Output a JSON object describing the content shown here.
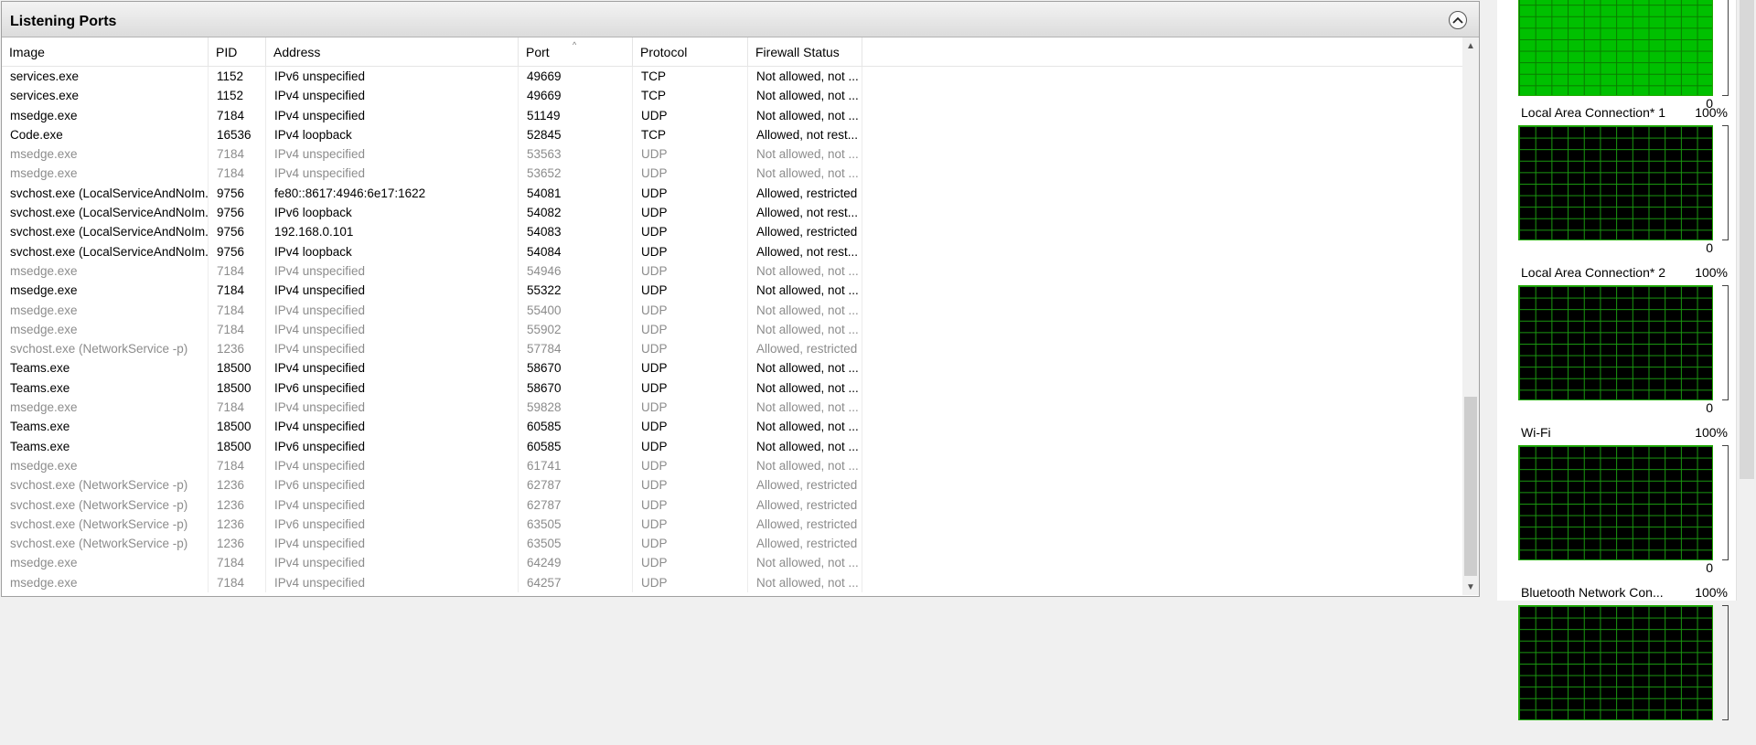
{
  "panel": {
    "title": "Listening Ports",
    "collapse_icon": "chevron-up-icon"
  },
  "columns": [
    "Image",
    "PID",
    "Address",
    "Port",
    "Protocol",
    "Firewall Status"
  ],
  "sorted_column": "Port",
  "rows": [
    {
      "image": "services.exe",
      "pid": "1152",
      "address": "IPv6 unspecified",
      "port": "49669",
      "protocol": "TCP",
      "firewall": "Not allowed, not ...",
      "dim": false
    },
    {
      "image": "services.exe",
      "pid": "1152",
      "address": "IPv4 unspecified",
      "port": "49669",
      "protocol": "TCP",
      "firewall": "Not allowed, not ...",
      "dim": false
    },
    {
      "image": "msedge.exe",
      "pid": "7184",
      "address": "IPv4 unspecified",
      "port": "51149",
      "protocol": "UDP",
      "firewall": "Not allowed, not ...",
      "dim": false
    },
    {
      "image": "Code.exe",
      "pid": "16536",
      "address": "IPv4 loopback",
      "port": "52845",
      "protocol": "TCP",
      "firewall": "Allowed, not rest...",
      "dim": false
    },
    {
      "image": "msedge.exe",
      "pid": "7184",
      "address": "IPv4 unspecified",
      "port": "53563",
      "protocol": "UDP",
      "firewall": "Not allowed, not ...",
      "dim": true
    },
    {
      "image": "msedge.exe",
      "pid": "7184",
      "address": "IPv4 unspecified",
      "port": "53652",
      "protocol": "UDP",
      "firewall": "Not allowed, not ...",
      "dim": true
    },
    {
      "image": "svchost.exe (LocalServiceAndNoIm...",
      "pid": "9756",
      "address": "fe80::8617:4946:6e17:1622",
      "port": "54081",
      "protocol": "UDP",
      "firewall": "Allowed, restricted",
      "dim": false
    },
    {
      "image": "svchost.exe (LocalServiceAndNoIm...",
      "pid": "9756",
      "address": "IPv6 loopback",
      "port": "54082",
      "protocol": "UDP",
      "firewall": "Allowed, not rest...",
      "dim": false
    },
    {
      "image": "svchost.exe (LocalServiceAndNoIm...",
      "pid": "9756",
      "address": "192.168.0.101",
      "port": "54083",
      "protocol": "UDP",
      "firewall": "Allowed, restricted",
      "dim": false
    },
    {
      "image": "svchost.exe (LocalServiceAndNoIm...",
      "pid": "9756",
      "address": "IPv4 loopback",
      "port": "54084",
      "protocol": "UDP",
      "firewall": "Allowed, not rest...",
      "dim": false
    },
    {
      "image": "msedge.exe",
      "pid": "7184",
      "address": "IPv4 unspecified",
      "port": "54946",
      "protocol": "UDP",
      "firewall": "Not allowed, not ...",
      "dim": true
    },
    {
      "image": "msedge.exe",
      "pid": "7184",
      "address": "IPv4 unspecified",
      "port": "55322",
      "protocol": "UDP",
      "firewall": "Not allowed, not ...",
      "dim": false
    },
    {
      "image": "msedge.exe",
      "pid": "7184",
      "address": "IPv4 unspecified",
      "port": "55400",
      "protocol": "UDP",
      "firewall": "Not allowed, not ...",
      "dim": true
    },
    {
      "image": "msedge.exe",
      "pid": "7184",
      "address": "IPv4 unspecified",
      "port": "55902",
      "protocol": "UDP",
      "firewall": "Not allowed, not ...",
      "dim": true
    },
    {
      "image": "svchost.exe (NetworkService -p)",
      "pid": "1236",
      "address": "IPv4 unspecified",
      "port": "57784",
      "protocol": "UDP",
      "firewall": "Allowed, restricted",
      "dim": true
    },
    {
      "image": "Teams.exe",
      "pid": "18500",
      "address": "IPv4 unspecified",
      "port": "58670",
      "protocol": "UDP",
      "firewall": "Not allowed, not ...",
      "dim": false
    },
    {
      "image": "Teams.exe",
      "pid": "18500",
      "address": "IPv6 unspecified",
      "port": "58670",
      "protocol": "UDP",
      "firewall": "Not allowed, not ...",
      "dim": false
    },
    {
      "image": "msedge.exe",
      "pid": "7184",
      "address": "IPv4 unspecified",
      "port": "59828",
      "protocol": "UDP",
      "firewall": "Not allowed, not ...",
      "dim": true
    },
    {
      "image": "Teams.exe",
      "pid": "18500",
      "address": "IPv4 unspecified",
      "port": "60585",
      "protocol": "UDP",
      "firewall": "Not allowed, not ...",
      "dim": false
    },
    {
      "image": "Teams.exe",
      "pid": "18500",
      "address": "IPv6 unspecified",
      "port": "60585",
      "protocol": "UDP",
      "firewall": "Not allowed, not ...",
      "dim": false
    },
    {
      "image": "msedge.exe",
      "pid": "7184",
      "address": "IPv4 unspecified",
      "port": "61741",
      "protocol": "UDP",
      "firewall": "Not allowed, not ...",
      "dim": true
    },
    {
      "image": "svchost.exe (NetworkService -p)",
      "pid": "1236",
      "address": "IPv6 unspecified",
      "port": "62787",
      "protocol": "UDP",
      "firewall": "Allowed, restricted",
      "dim": true
    },
    {
      "image": "svchost.exe (NetworkService -p)",
      "pid": "1236",
      "address": "IPv4 unspecified",
      "port": "62787",
      "protocol": "UDP",
      "firewall": "Allowed, restricted",
      "dim": true
    },
    {
      "image": "svchost.exe (NetworkService -p)",
      "pid": "1236",
      "address": "IPv6 unspecified",
      "port": "63505",
      "protocol": "UDP",
      "firewall": "Allowed, restricted",
      "dim": true
    },
    {
      "image": "svchost.exe (NetworkService -p)",
      "pid": "1236",
      "address": "IPv4 unspecified",
      "port": "63505",
      "protocol": "UDP",
      "firewall": "Allowed, restricted",
      "dim": true
    },
    {
      "image": "msedge.exe",
      "pid": "7184",
      "address": "IPv4 unspecified",
      "port": "64249",
      "protocol": "UDP",
      "firewall": "Not allowed, not ...",
      "dim": true
    },
    {
      "image": "msedge.exe",
      "pid": "7184",
      "address": "IPv4 unspecified",
      "port": "64257",
      "protocol": "UDP",
      "firewall": "Not allowed, not ...",
      "dim": true
    }
  ],
  "graphs": [
    {
      "label": "",
      "pct": "",
      "zero": "0",
      "filled": true
    },
    {
      "label": "Local Area Connection* 1",
      "pct": "100%",
      "zero": "0",
      "filled": false
    },
    {
      "label": "Local Area Connection* 2",
      "pct": "100%",
      "zero": "0",
      "filled": false
    },
    {
      "label": "Wi-Fi",
      "pct": "100%",
      "zero": "0",
      "filled": false
    },
    {
      "label": "Bluetooth Network Con...",
      "pct": "100%",
      "zero": "",
      "filled": false
    }
  ],
  "colors": {
    "graph_green": "#1faa00",
    "dim_text": "#8c8c8c"
  }
}
